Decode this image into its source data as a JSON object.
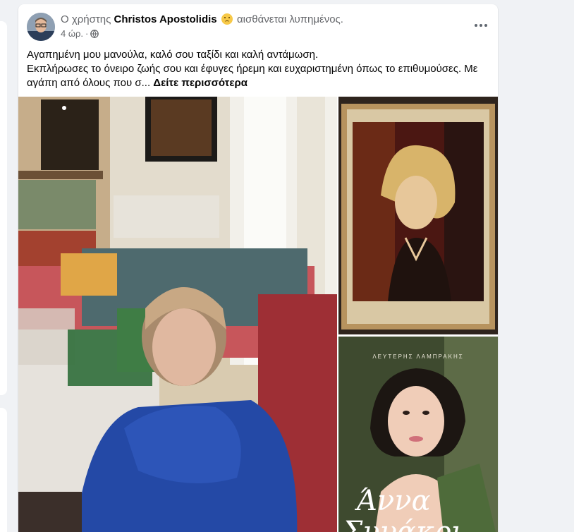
{
  "post": {
    "prefix": "Ο χρήστης",
    "author": "Christos Apostolidis",
    "feeling_icon": "sad-face-emoji",
    "feeling": "αισθάνεται λυπημένος.",
    "time": "4 ώρ.",
    "dot": "·",
    "privacy_icon": "globe-icon",
    "text_line1": "Αγαπημένη μου μανούλα, καλό σου ταξίδι και καλή αντάμωση.",
    "text_line2": "Εκπλήρωσες το όνειρο ζωής σου και έφυγες ήρεμη και ευχαριστημένη όπως το επιθυμούσες. Με αγάπη από όλους που σ...",
    "see_more": "Δείτε περισσότερα"
  },
  "photos": {
    "book_author": "ΛΕΥΤΕΡΗΣ ΛΑΜΠΡΑΚΗΣ",
    "book_title_line1": "Άννα",
    "book_title_line2": "Συνάκρι"
  },
  "colors": {
    "background": "#f0f2f5",
    "card": "#ffffff",
    "secondary_text": "#65676b",
    "primary_text": "#050505"
  }
}
